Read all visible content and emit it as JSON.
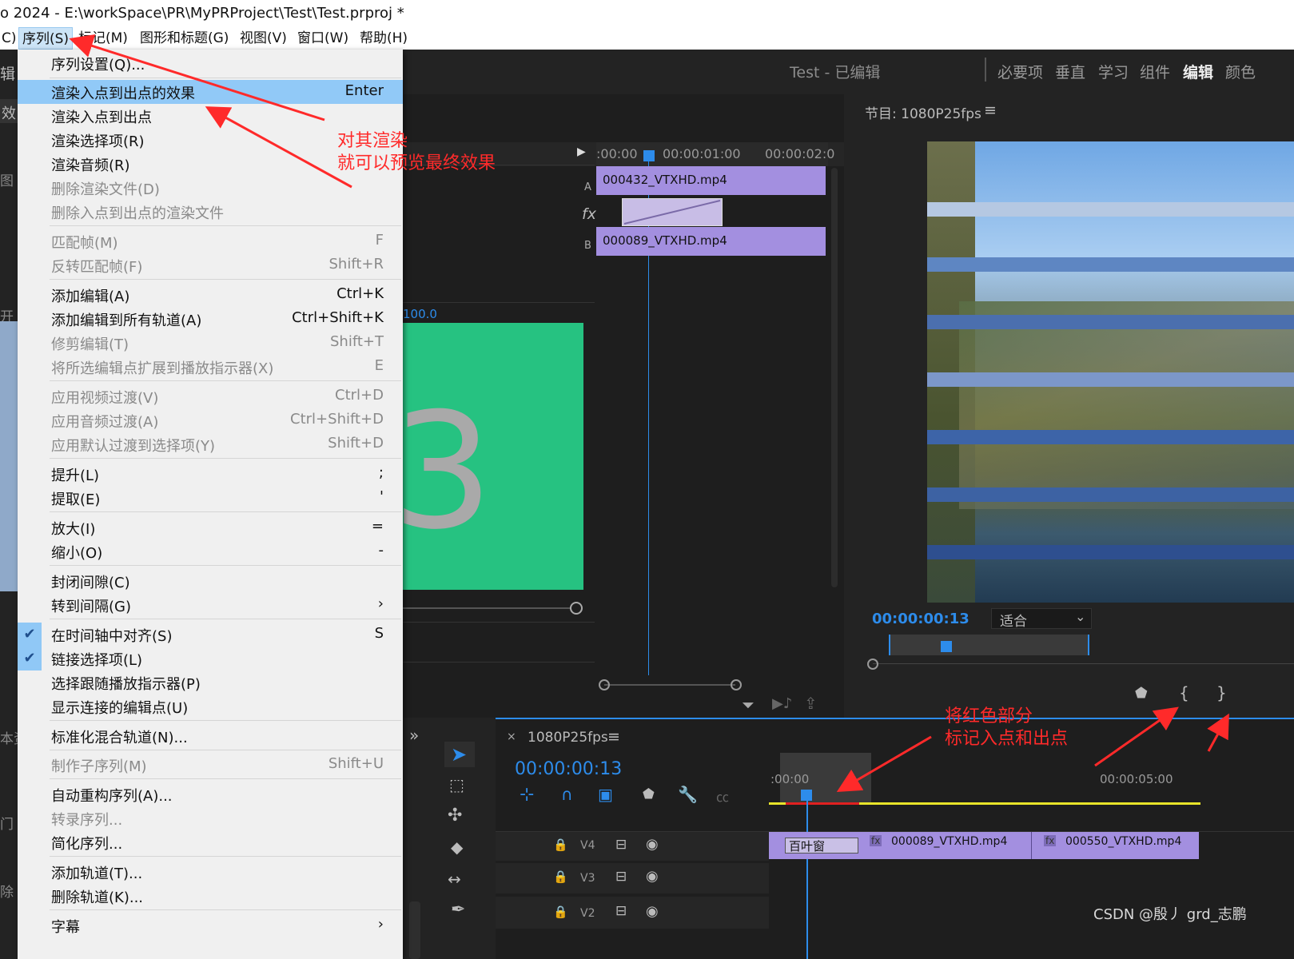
{
  "title": "o 2024 - E:\\workSpace\\PR\\MyPRProject\\Test\\Test.prproj *",
  "menubar": [
    {
      "label": "C)"
    },
    {
      "label": "序列(S)"
    },
    {
      "label": "标记(M)"
    },
    {
      "label": "图形和标题(G)"
    },
    {
      "label": "视图(V)"
    },
    {
      "label": "窗口(W)"
    },
    {
      "label": "帮助(H)"
    }
  ],
  "sequence_menu": [
    {
      "label": "序列设置(Q)...",
      "shortcut": ""
    },
    {
      "label": "渲染入点到出点的效果",
      "shortcut": "Enter"
    },
    {
      "label": "渲染入点到出点",
      "shortcut": ""
    },
    {
      "label": "渲染选择项(R)",
      "shortcut": ""
    },
    {
      "label": "渲染音频(R)",
      "shortcut": ""
    },
    {
      "label": "删除渲染文件(D)",
      "shortcut": ""
    },
    {
      "label": "删除入点到出点的渲染文件",
      "shortcut": ""
    },
    {
      "label": "匹配帧(M)",
      "shortcut": "F"
    },
    {
      "label": "反转匹配帧(F)",
      "shortcut": "Shift+R"
    },
    {
      "label": "添加编辑(A)",
      "shortcut": "Ctrl+K"
    },
    {
      "label": "添加编辑到所有轨道(A)",
      "shortcut": "Ctrl+Shift+K"
    },
    {
      "label": "修剪编辑(T)",
      "shortcut": "Shift+T"
    },
    {
      "label": "将所选编辑点扩展到播放指示器(X)",
      "shortcut": "E"
    },
    {
      "label": "应用视频过渡(V)",
      "shortcut": "Ctrl+D"
    },
    {
      "label": "应用音频过渡(A)",
      "shortcut": "Ctrl+Shift+D"
    },
    {
      "label": "应用默认过渡到选择项(Y)",
      "shortcut": "Shift+D"
    },
    {
      "label": "提升(L)",
      "shortcut": ";"
    },
    {
      "label": "提取(E)",
      "shortcut": "'"
    },
    {
      "label": "放大(I)",
      "shortcut": "="
    },
    {
      "label": "缩小(O)",
      "shortcut": "-"
    },
    {
      "label": "封闭间隙(C)",
      "shortcut": ""
    },
    {
      "label": "转到间隔(G)",
      "shortcut": "›"
    },
    {
      "label": "在时间轴中对齐(S)",
      "shortcut": "S"
    },
    {
      "label": "链接选择项(L)",
      "shortcut": ""
    },
    {
      "label": "选择跟随播放指示器(P)",
      "shortcut": ""
    },
    {
      "label": "显示连接的编辑点(U)",
      "shortcut": ""
    },
    {
      "label": "标准化混合轨道(N)...",
      "shortcut": ""
    },
    {
      "label": "制作子序列(M)",
      "shortcut": "Shift+U"
    },
    {
      "label": "自动重构序列(A)...",
      "shortcut": ""
    },
    {
      "label": "转录序列...",
      "shortcut": ""
    },
    {
      "label": "简化序列...",
      "shortcut": ""
    },
    {
      "label": "添加轨道(T)...",
      "shortcut": ""
    },
    {
      "label": "删除轨道(K)...",
      "shortcut": ""
    },
    {
      "label": "字幕",
      "shortcut": "›"
    }
  ],
  "annotations": {
    "render": [
      "对其渲染",
      "就可以预览最终效果"
    ],
    "mark": [
      "将红色部分",
      "标记入点和出点"
    ]
  },
  "workspace": {
    "project": "Test - 已编辑",
    "tabs": [
      "必要项",
      "垂直",
      "学习",
      "组件",
      "编辑",
      "颜色"
    ]
  },
  "left_fragments": [
    "辑",
    "效",
    "图",
    "开",
    "本资",
    "门",
    "除"
  ],
  "effect_controls": {
    "ruler": [
      ":00:00",
      "00:00:01:00",
      "00:00:02:0"
    ],
    "track_a": "A",
    "track_b": "B",
    "fx": "fx",
    "clip_a": "000432_VTXHD.mp4",
    "clip_b": "000089_VTXHD.mp4",
    "value": "100.0"
  },
  "program": {
    "title": "节目: 1080P25fps",
    "timecode": "00:00:00:13",
    "fit": "适合"
  },
  "timeline": {
    "sequence": "1080P25fps",
    "timecode": "00:00:00:13",
    "ruler": [
      ":00:00",
      "00:00:05:00"
    ],
    "tracks": [
      "V4",
      "V3",
      "V2"
    ],
    "transition": "百叶窗",
    "clips": [
      "000089_VTXHD.mp4",
      "000550_VTXHD.mp4"
    ]
  },
  "watermark": "CSDN @殷丿 grd_志鹏",
  "colors": {
    "accent": "#2d8ceb",
    "clip": "#a38fe0",
    "render_bar": "#e8e42a",
    "annotation": "#ff2a2a",
    "green_panel": "#26c281"
  }
}
